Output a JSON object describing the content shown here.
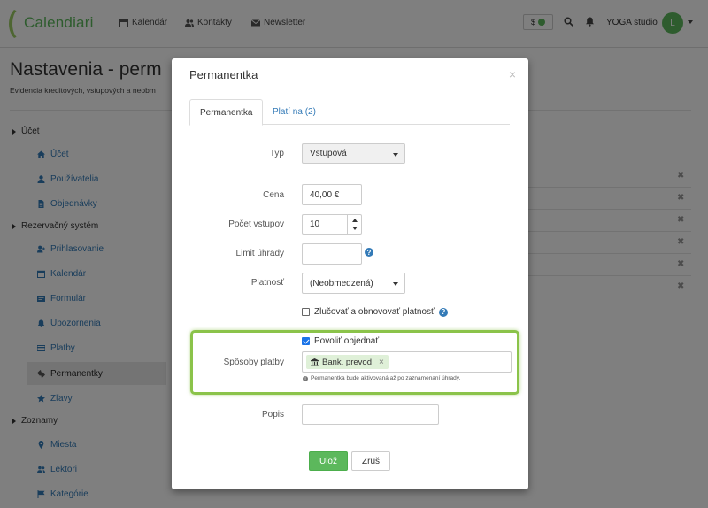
{
  "brand": {
    "name": "Calendiari"
  },
  "nav": {
    "items": [
      {
        "label": "Kalendár",
        "icon": "calendar-icon"
      },
      {
        "label": "Kontakty",
        "icon": "users-icon"
      },
      {
        "label": "Newsletter",
        "icon": "envelope-icon"
      }
    ],
    "credit_symbol": "$",
    "studio": "YOGA studio",
    "avatar_initial": "L"
  },
  "page": {
    "title": "Nastavenia - perm",
    "subtitle": "Evidencia kreditových, vstupových a neobm"
  },
  "sidebar": {
    "groups": [
      {
        "label": "Účet",
        "items": [
          {
            "label": "Účet",
            "icon": "home-icon"
          },
          {
            "label": "Používatelia",
            "icon": "user-icon"
          },
          {
            "label": "Objednávky",
            "icon": "file-icon"
          }
        ]
      },
      {
        "label": "Rezervačný systém",
        "items": [
          {
            "label": "Prihlasovanie",
            "icon": "user-plus-icon"
          },
          {
            "label": "Kalendár",
            "icon": "calendar-icon"
          },
          {
            "label": "Formulár",
            "icon": "form-icon"
          },
          {
            "label": "Upozornenia",
            "icon": "bell-icon"
          },
          {
            "label": "Platby",
            "icon": "card-icon"
          },
          {
            "label": "Permanentky",
            "icon": "ticket-icon",
            "active": true
          },
          {
            "label": "Zľavy",
            "icon": "star-icon"
          }
        ]
      },
      {
        "label": "Zoznamy",
        "items": [
          {
            "label": "Miesta",
            "icon": "map-marker-icon"
          },
          {
            "label": "Lektori",
            "icon": "users-icon"
          },
          {
            "label": "Kategórie",
            "icon": "flag-icon"
          }
        ]
      }
    ]
  },
  "modal": {
    "title": "Permanentka",
    "close": "×",
    "tabs": [
      {
        "label": "Permanentka",
        "active": true
      },
      {
        "label": "Platí na (2)",
        "active": false
      }
    ],
    "fields": {
      "type": {
        "label": "Typ",
        "value": "Vstupová"
      },
      "price": {
        "label": "Cena",
        "value": "40,00 €"
      },
      "entries": {
        "label": "Počet vstupov",
        "value": "10"
      },
      "payment_limit": {
        "label": "Limit úhrady",
        "value": ""
      },
      "validity": {
        "label": "Platnosť",
        "value": "(Neobmedzená)"
      },
      "merge": {
        "label": "Zlučovať a obnovovať platnosť",
        "checked": false
      },
      "allow_order": {
        "label": "Povoliť objednať",
        "checked": true
      },
      "payment_methods": {
        "label": "Spôsoby platby",
        "tags": [
          {
            "label": "Bank. prevod",
            "icon": "bank-icon"
          }
        ],
        "hint": "Permanentka bude aktivovaná až po zaznamenaní úhrady."
      },
      "description": {
        "label": "Popis",
        "value": ""
      }
    },
    "buttons": {
      "save": "Ulož",
      "cancel": "Zruš"
    },
    "colors": {
      "save_bg": "#5cb85c",
      "highlight": "#8bc34a",
      "link": "#337ab7"
    }
  }
}
